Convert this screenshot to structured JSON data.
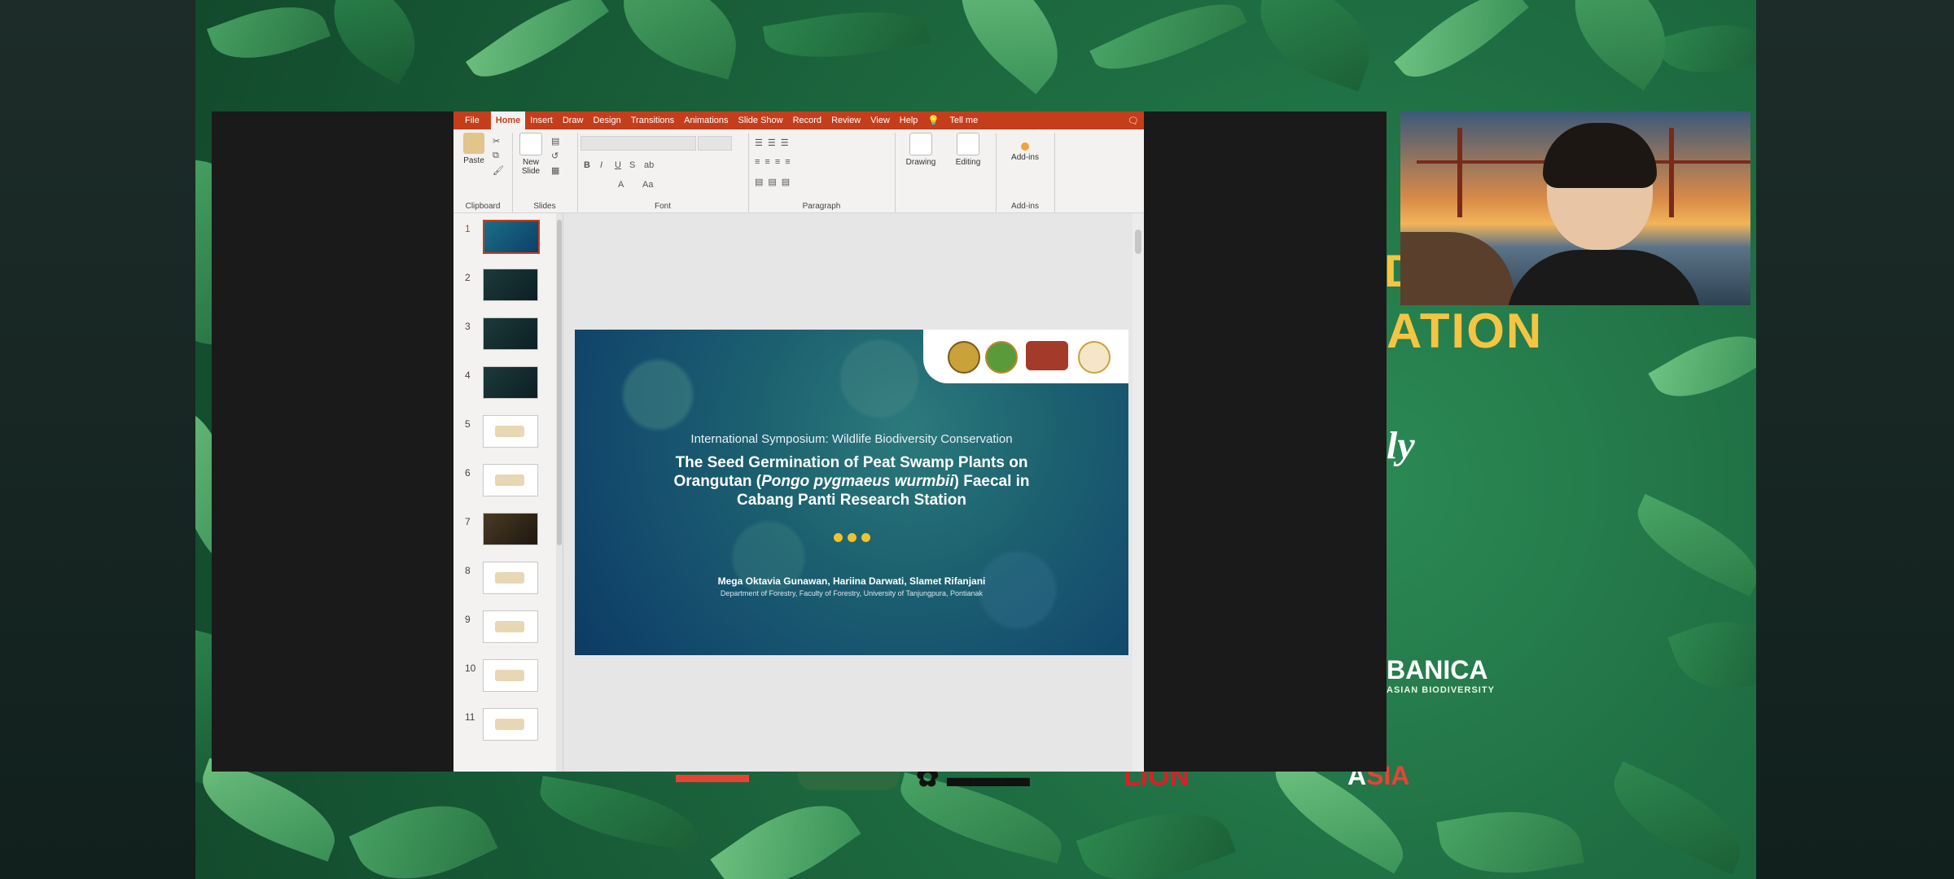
{
  "ppt": {
    "tabs": [
      "File",
      "Home",
      "Insert",
      "Draw",
      "Design",
      "Transitions",
      "Animations",
      "Slide Show",
      "Record",
      "Review",
      "View",
      "Help"
    ],
    "tell_me": "Tell me",
    "groups": {
      "clipboard": "Clipboard",
      "slides": "Slides",
      "font": "Font",
      "paragraph": "Paragraph",
      "addins": "Add-ins"
    },
    "buttons": {
      "paste": "Paste",
      "new_slide": "New Slide",
      "drawing": "Drawing",
      "editing": "Editing",
      "addins": "Add-ins"
    },
    "font_buttons": [
      "B",
      "I",
      "U",
      "S",
      "ab",
      "A",
      "Aa"
    ],
    "thumbnails": [
      "1",
      "2",
      "3",
      "4",
      "5",
      "6",
      "7",
      "8",
      "9",
      "10",
      "11"
    ]
  },
  "slide": {
    "subtitle": "International Symposium: Wildlife Biodiversity Conservation",
    "title_line1": "The Seed Germination of Peat Swamp Plants on",
    "title_line2a": "Orangutan (",
    "title_italic": "Pongo pygmaeus wurmbii",
    "title_line2b": ") Faecal in",
    "title_line3": "Cabang Panti Research Station",
    "authors": "Mega Oktavia Gunawan, Hariina Darwati, Slamet Rifanjani",
    "affiliation": "Department of Forestry, Faculty of Forestry, University of Tanjungpura, Pontianak"
  },
  "banner": {
    "partial_title": "ATION",
    "partial_d": "D",
    "partial_y": "ly",
    "banica": "BANICA",
    "banica_sub": "ASIAN BIODIVERSITY",
    "sponsor4": "LION",
    "sponsor5a": "A",
    "sponsor5b": "SIA"
  },
  "colors": {
    "ppt_accent": "#c43e1c",
    "banner_gold": "#f4c542",
    "slide_dots": "#f2c12e"
  }
}
